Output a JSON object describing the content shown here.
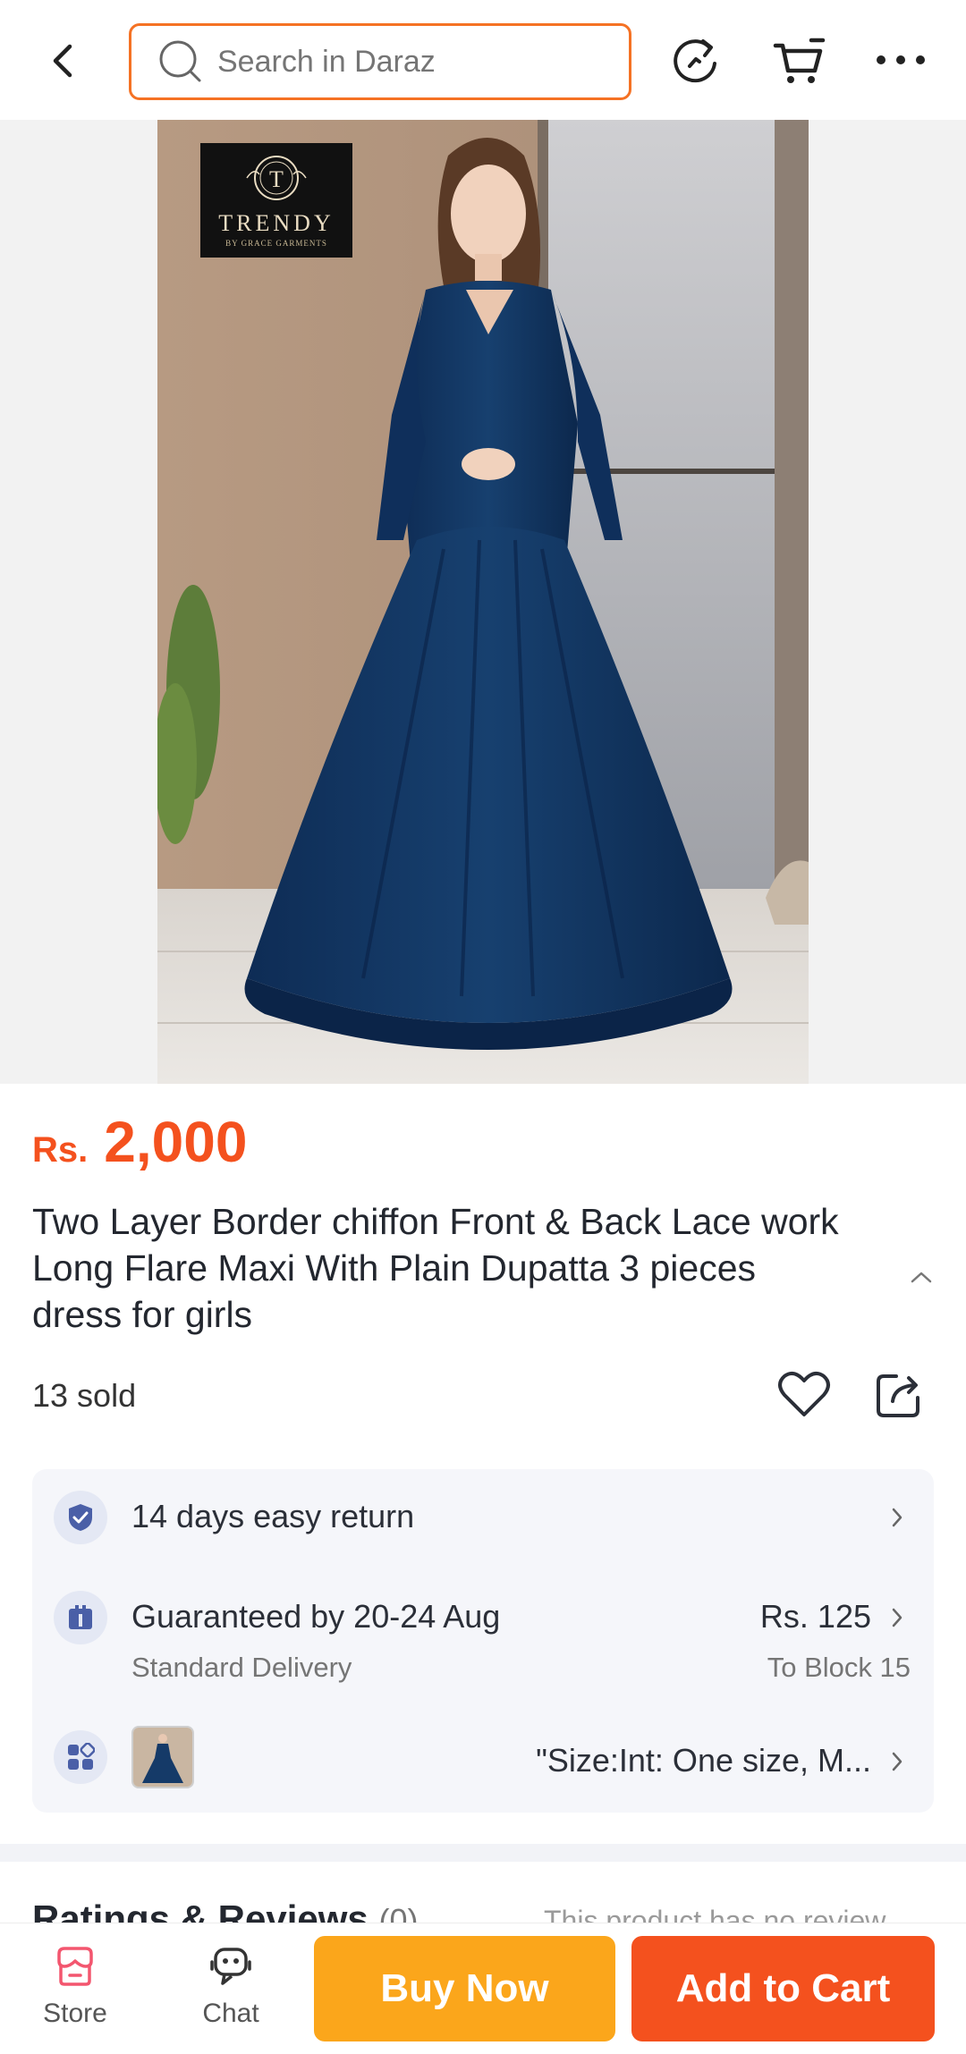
{
  "header": {
    "search_placeholder": "Search in Daraz",
    "accent_color": "#f57224"
  },
  "product_image": {
    "brand_badge_name": "TRENDY",
    "brand_badge_sub": "BY GRACE GARMENTS"
  },
  "product": {
    "currency": "Rs.",
    "price": "2,000",
    "title": "Two Layer Border chiffon Front & Back Lace work Long Flare Maxi With Plain Dupatta 3 pieces dress for girls",
    "sold": "13 sold",
    "price_color": "#f4511e"
  },
  "info": {
    "return_text": "14 days easy return",
    "delivery_title": "Guaranteed by 20-24 Aug",
    "delivery_sub": "Standard Delivery",
    "delivery_price": "Rs. 125",
    "delivery_location": "To Block 15",
    "variant_text": "\"Size:Int: One size, M..."
  },
  "ratings": {
    "title": "Ratings & Reviews",
    "count": "(0)",
    "empty_text": "This product has no review"
  },
  "bottom_bar": {
    "store_label": "Store",
    "chat_label": "Chat",
    "buy_now_label": "Buy Now",
    "add_to_cart_label": "Add to Cart",
    "buy_now_color": "#fba61b",
    "add_to_cart_color": "#f4511e"
  }
}
